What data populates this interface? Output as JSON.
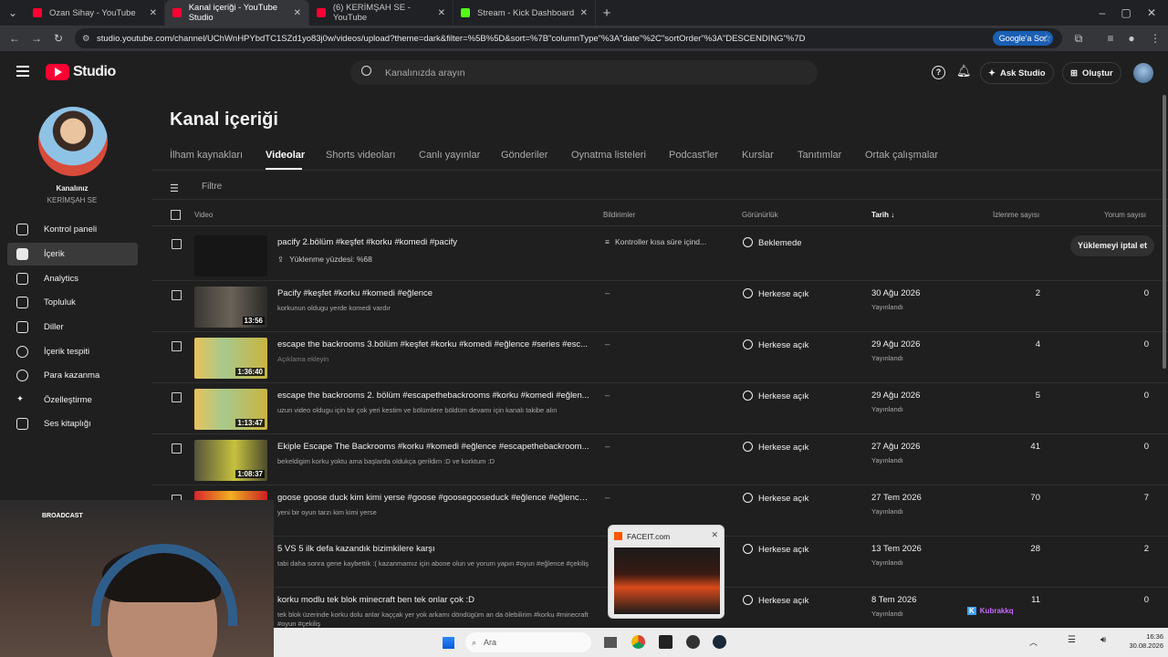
{
  "browser": {
    "tabs": [
      {
        "label": "Ozan Sihay - YouTube",
        "color": "#ff0033"
      },
      {
        "label": "Kanal içeriği - YouTube Studio",
        "color": "#ff0033"
      },
      {
        "label": "(6) KERİMŞAH SE - YouTube",
        "color": "#ff0033"
      },
      {
        "label": "Stream - Kick Dashboard",
        "color": "#53fc18"
      }
    ],
    "url": "studio.youtube.com/channel/UChWnHPYbdTC1SZd1yo83j0w/videos/upload?theme=dark&filter=%5B%5D&sort=%7B\"columnType\"%3A\"date\"%2C\"sortOrder\"%3A\"DESCENDING\"%7D",
    "google_sor": "Google'a Sor"
  },
  "header": {
    "logo": "Studio",
    "search_placeholder": "Kanalınızda arayın",
    "ask_studio": "Ask Studio",
    "create": "Oluştur"
  },
  "sidebar": {
    "channel_caption": "Kanalınız",
    "channel_name": "KERİMŞAH SE",
    "items": [
      {
        "label": "Kontrol paneli",
        "icon": "dashboard-icon"
      },
      {
        "label": "İçerik",
        "icon": "content-icon"
      },
      {
        "label": "Analytics",
        "icon": "analytics-icon"
      },
      {
        "label": "Topluluk",
        "icon": "community-icon"
      },
      {
        "label": "Diller",
        "icon": "subtitles-icon"
      },
      {
        "label": "İçerik tespiti",
        "icon": "copyright-icon"
      },
      {
        "label": "Para kazanma",
        "icon": "money-icon"
      },
      {
        "label": "Özelleştirme",
        "icon": "customization-icon"
      },
      {
        "label": "Ses kitaplığı",
        "icon": "audio-library-icon"
      }
    ]
  },
  "main": {
    "title": "Kanal içeriği",
    "tabs": [
      "İlham kaynakları",
      "Videolar",
      "Shorts videoları",
      "Canlı yayınlar",
      "Gönderiler",
      "Oynatma listeleri",
      "Podcast'ler",
      "Kurslar",
      "Tanıtımlar",
      "Ortak çalışmalar"
    ],
    "filter_placeholder": "Filtre",
    "columns": {
      "video": "Video",
      "notifications": "Bildirimler",
      "visibility": "Görünürlük",
      "date": "Tarih",
      "views": "İzlenme sayısı",
      "comments": "Yorum sayısı"
    },
    "rows": [
      {
        "title": "pacify 2.bölüm #keşfet #korku #komedi #pacify",
        "desc": "Yüklenme yüzdesi: %68",
        "duration": "",
        "notice": "Kontroller kısa süre içind...",
        "visibility": "Beklemede",
        "date": "",
        "status": "",
        "views": "",
        "comments": "",
        "action": "Yüklemeyi iptal et"
      },
      {
        "title": "Pacify #keşfet #korku #komedi #eğlence",
        "desc": "korkunun oldugu yerde komedi vardır",
        "duration": "13:56",
        "notice": "–",
        "visibility": "Herkese açık",
        "date": "30 Ağu 2026",
        "status": "Yayınlandı",
        "views": "2",
        "comments": "0"
      },
      {
        "title": "escape the backrooms 3.bölüm #keşfet #korku #komedi #eğlence #series #esc...",
        "desc": "Açıklama ekleyin",
        "duration": "1:36:40",
        "notice": "–",
        "visibility": "Herkese açık",
        "date": "29 Ağu 2026",
        "status": "Yayınlandı",
        "views": "4",
        "comments": "0"
      },
      {
        "title": "escape the backrooms 2. bölüm #escapethebackrooms #korku #komedi #eğlen...",
        "desc": "uzun video oldugu için bir çok yeri kestim ve bölümlere böldüm devamı için kanalı takibe alın",
        "duration": "1:13:47",
        "notice": "–",
        "visibility": "Herkese açık",
        "date": "29 Ağu 2026",
        "status": "Yayınlandı",
        "views": "5",
        "comments": "0"
      },
      {
        "title": "Ekiple Escape The Backrooms #korku #komedi #eğlence #escapethebackroom...",
        "desc": "bekeldigim korku yoktu ama başlarda oldukça gerildim :D ve korktum :D",
        "duration": "1:08:37",
        "notice": "–",
        "visibility": "Herkese açık",
        "date": "27 Ağu 2026",
        "status": "Yayınlandı",
        "views": "41",
        "comments": "0"
      },
      {
        "title": "goose goose duck kim kimi yerse #goose #goosegooseduck #eğlence #eğlence...",
        "desc": "yeni bir oyun tarzı kim kimi yerse",
        "duration": "",
        "notice": "–",
        "visibility": "Herkese açık",
        "date": "27 Tem 2026",
        "status": "Yayınlandı",
        "views": "70",
        "comments": "7"
      },
      {
        "title": "5 VS 5 ilk defa kazandık bizimkilere karşı",
        "desc": "tabi daha sonra gene kaybettik :( kazanmamız için abone olun ve yorum yapın #oyun #eğlence #çekiliş",
        "duration": "",
        "notice": "–",
        "visibility": "Herkese açık",
        "date": "13 Tem 2026",
        "status": "Yayınlandı",
        "views": "28",
        "comments": "2"
      },
      {
        "title": "korku modlu tek blok minecraft ben tek onlar çok :D",
        "desc": "tek blok üzerinde korku dolu anlar kaççak yer yok arkamı döndügüm an da ölebilirim #korku #minecraft #oyun #çekiliş",
        "duration": "",
        "notice": "–",
        "visibility": "Herkese açık",
        "date": "8 Tem 2026",
        "status": "Yayınlandı",
        "views": "11",
        "comments": "0"
      }
    ]
  },
  "overlay": {
    "broadcast_label": "BROADCAST",
    "preview_title": "FACEIT.com",
    "kick_user": "Kubrakkq",
    "taskbar_search": "Ara",
    "clock_time": "16:36",
    "clock_date": "30.08.2026"
  }
}
